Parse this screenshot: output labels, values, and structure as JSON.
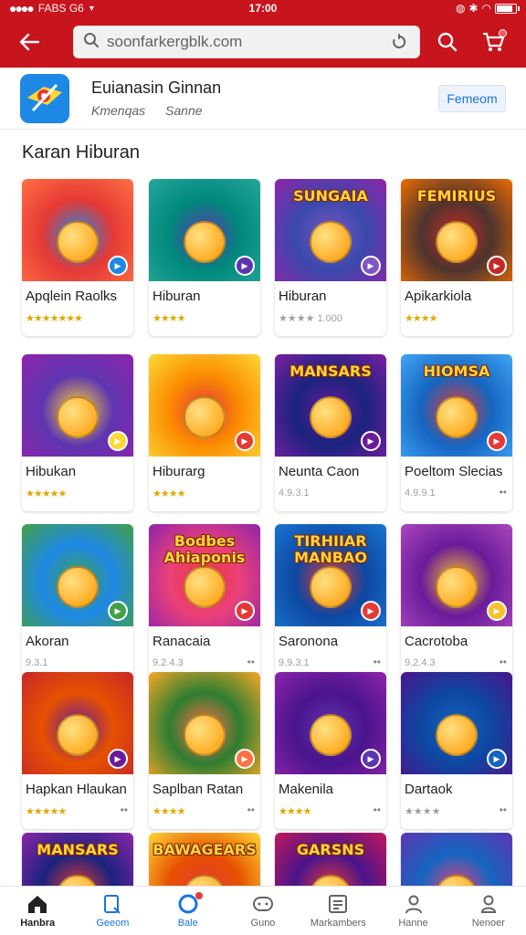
{
  "status_bar": {
    "carrier": "FABS G6",
    "time": "17:00",
    "battery_level": 0.9
  },
  "search": {
    "value": "soonfarkergblk.com"
  },
  "app_header": {
    "name": "Euianasin Ginnan",
    "sub1": "Kmenqas",
    "sub2": "Sanne",
    "action_label": "Femeom"
  },
  "section_title": "Karan Hiburan",
  "cards": [
    {
      "name": "Apqlein Raolks",
      "rating": "★★★★★★★",
      "rating_style": "gold",
      "thumb_text": "",
      "colors": [
        "#e53935",
        "#ff7043"
      ],
      "accent": "#1e88e5",
      "more": ""
    },
    {
      "name": "Hiburan",
      "rating": "★★★★",
      "rating_style": "gold",
      "thumb_text": "",
      "colors": [
        "#00897b",
        "#26a69a"
      ],
      "accent": "#5e35b1",
      "more": ""
    },
    {
      "name": "Hiburan",
      "rating": "★★★★ 1.000",
      "rating_style": "grey",
      "thumb_text": "SUNGAIA",
      "colors": [
        "#3949ab",
        "#8e24aa"
      ],
      "accent": "#7e57c2",
      "more": ""
    },
    {
      "name": "Apikarkiola",
      "rating": "★★★★",
      "rating_style": "gold",
      "thumb_text": "FEMIRIUS",
      "colors": [
        "#4e342e",
        "#ef6c00"
      ],
      "accent": "#c62828",
      "more": ""
    },
    {
      "name": "Hibukan",
      "rating": "★★★★★",
      "rating_style": "gold",
      "thumb_text": "",
      "colors": [
        "#5e35b1",
        "#8e24aa"
      ],
      "accent": "#fdd835",
      "more": ""
    },
    {
      "name": "Hiburarg",
      "rating": "★★★★",
      "rating_style": "gold",
      "thumb_text": "",
      "colors": [
        "#fb8c00",
        "#fdd835"
      ],
      "accent": "#e53935",
      "more": ""
    },
    {
      "name": "Neunta Caon",
      "rating": "4.9.3.1",
      "rating_style": "grey",
      "thumb_text": "MANSARS",
      "colors": [
        "#1a237e",
        "#7b1fa2"
      ],
      "accent": "#6a1b9a",
      "more": ""
    },
    {
      "name": "Poeltom Slecias",
      "rating": "4.9.9.1",
      "rating_style": "grey",
      "thumb_text": "HIOMSA",
      "colors": [
        "#1565c0",
        "#42a5f5"
      ],
      "accent": "#e53935",
      "more": "••"
    },
    {
      "name": "Akoran",
      "rating": "9.3.1",
      "rating_style": "grey",
      "thumb_text": "",
      "colors": [
        "#1e88e5",
        "#43a047"
      ],
      "accent": "#43a047",
      "more": ""
    },
    {
      "name": "Ranacaia",
      "rating": "9.2.4.3",
      "rating_style": "grey",
      "thumb_text": "Bodbes Ahiaponis",
      "colors": [
        "#ec407a",
        "#8e24aa"
      ],
      "accent": "#e53935",
      "more": "••"
    },
    {
      "name": "Saronona",
      "rating": "9.9.3.1",
      "rating_style": "grey",
      "thumb_text": "TIRHIIAR MANBAO",
      "colors": [
        "#0d47a1",
        "#1976d2"
      ],
      "accent": "#e53935",
      "more": "••"
    },
    {
      "name": "Cacrotoba",
      "rating": "9.2.4.3",
      "rating_style": "grey",
      "thumb_text": "",
      "colors": [
        "#6a1b9a",
        "#ab47bc"
      ],
      "accent": "#fbc02d",
      "more": "••"
    },
    {
      "name": "Hapkan Hlaukan",
      "rating": "★★★★★",
      "rating_style": "gold",
      "thumb_text": "",
      "colors": [
        "#e65100",
        "#c62828"
      ],
      "accent": "#6a1b9a",
      "more": "••"
    },
    {
      "name": "Saplban Ratan",
      "rating": "★★★★",
      "rating_style": "gold",
      "thumb_text": "",
      "colors": [
        "#2e7d32",
        "#f9a825"
      ],
      "accent": "#ff7043",
      "more": "••"
    },
    {
      "name": "Makenila",
      "rating": "★★★★",
      "rating_style": "gold",
      "thumb_text": "",
      "colors": [
        "#4a148c",
        "#8e24aa"
      ],
      "accent": "#5e35b1",
      "more": "••"
    },
    {
      "name": "Dartaok",
      "rating": "★★★★",
      "rating_style": "grey",
      "thumb_text": "",
      "colors": [
        "#0d47a1",
        "#4a148c"
      ],
      "accent": "#1565c0",
      "more": "••"
    },
    {
      "name": "",
      "rating": "",
      "rating_style": "grey",
      "thumb_text": "MANSARS",
      "colors": [
        "#1a237e",
        "#8e24aa"
      ],
      "accent": "#e53935",
      "more": ""
    },
    {
      "name": "",
      "rating": "",
      "rating_style": "grey",
      "thumb_text": "BAWAGEARS",
      "colors": [
        "#e65100",
        "#fdd835"
      ],
      "accent": "#e53935",
      "more": ""
    },
    {
      "name": "",
      "rating": "",
      "rating_style": "grey",
      "thumb_text": "GARSNS",
      "colors": [
        "#4a148c",
        "#c2185b"
      ],
      "accent": "#e53935",
      "more": ""
    },
    {
      "name": "",
      "rating": "",
      "rating_style": "grey",
      "thumb_text": "",
      "colors": [
        "#1565c0",
        "#5e35b1"
      ],
      "accent": "#ec407a",
      "more": ""
    }
  ],
  "bottom_nav": [
    {
      "label": "Hanbra",
      "icon": "home-icon"
    },
    {
      "label": "Geeom",
      "icon": "book-icon"
    },
    {
      "label": "Bale",
      "icon": "circle-icon"
    },
    {
      "label": "Guno",
      "icon": "controller-icon"
    },
    {
      "label": "Markambers",
      "icon": "list-icon"
    },
    {
      "label": "Hanne",
      "icon": "person-icon"
    },
    {
      "label": "Nenoer",
      "icon": "account-icon"
    }
  ],
  "colors": {
    "brand_red": "#c8141c",
    "link_blue": "#1a73e8"
  }
}
